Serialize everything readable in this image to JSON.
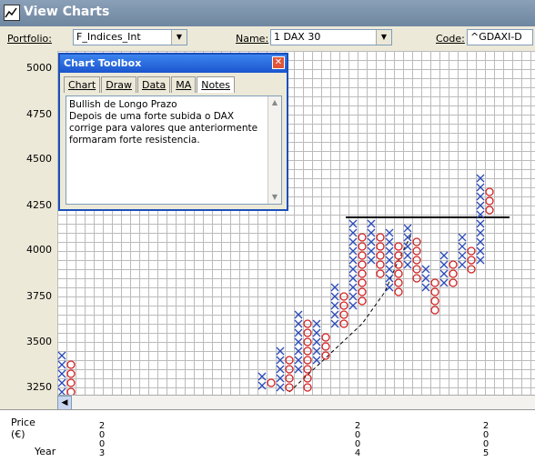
{
  "window": {
    "title": "View Charts"
  },
  "toolbar": {
    "portfolio_label": "Portfolio:",
    "portfolio_value": "F_Indices_Int",
    "name_label": "Name:",
    "name_value": "1 DAX 30",
    "code_label": "Code:",
    "code_value": "^GDAXI-D"
  },
  "y_axis": {
    "ticks": [
      "5000",
      "4750",
      "4500",
      "4250",
      "4000",
      "3750",
      "3500",
      "3250"
    ]
  },
  "x_axis": {
    "price_label": "Price",
    "price_unit": "(€)",
    "year_label": "Year",
    "years": [
      {
        "label": [
          "2",
          "0",
          "0",
          "3"
        ]
      },
      {
        "label": [
          "2",
          "0",
          "0",
          "4"
        ]
      },
      {
        "label": [
          "2",
          "0",
          "0",
          "5"
        ]
      }
    ]
  },
  "toolbox": {
    "title": "Chart Toolbox",
    "tabs": [
      "Chart",
      "Draw",
      "Data",
      "MA",
      "Notes"
    ],
    "active_tab": "Notes",
    "notes_text": "Bullish de Longo Prazo\nDepois de uma forte subida o DAX corrige para valores que anteriormente formaram forte resistencia."
  },
  "colors": {
    "x_mark": "#2a4ab8",
    "o_mark": "#d22020",
    "grid": "#bbbbbb"
  },
  "icons": {
    "app": "chart-icon",
    "close": "close-icon",
    "scroll_left": "left-arrow-icon"
  }
}
